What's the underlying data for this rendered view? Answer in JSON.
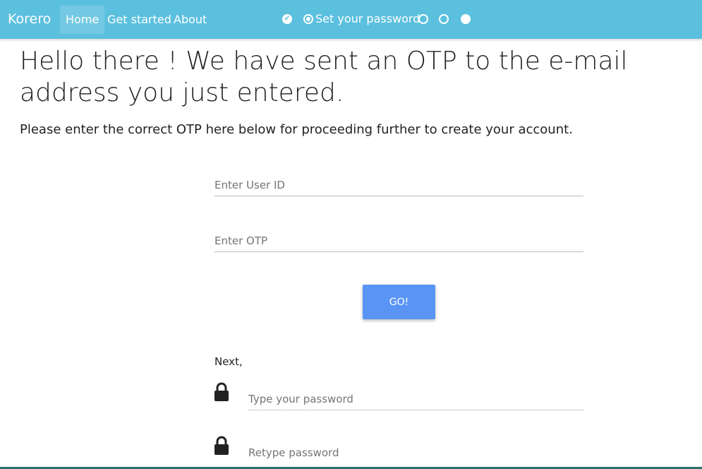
{
  "nav": {
    "brand": "Korero",
    "items": [
      "Home",
      "Get started",
      "About"
    ]
  },
  "steps": {
    "current_label": "Set your password",
    "states": [
      "done",
      "current",
      "empty",
      "empty",
      "full"
    ]
  },
  "page": {
    "headline": "Hello there ! We have sent an OTP to the e-mail address you just entered.",
    "subline": "Please enter the correct OTP here below for proceeding further to create your account."
  },
  "form": {
    "user_id_placeholder": "Enter User ID",
    "otp_placeholder": "Enter OTP",
    "go_label": "GO!",
    "next_label": "Next,",
    "password_placeholder": "Type your password",
    "retype_placeholder": "Retype password"
  },
  "colors": {
    "navbar": "#5bc0de",
    "button": "#5a95f5"
  },
  "icons": {
    "check": "check-circle-icon",
    "lock": "lock-icon"
  }
}
